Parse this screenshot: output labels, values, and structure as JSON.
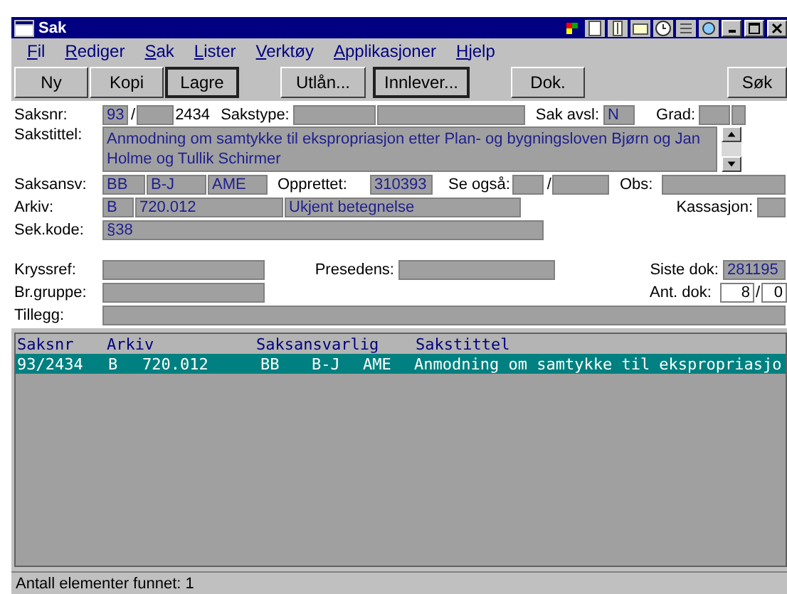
{
  "window": {
    "title": "Sak"
  },
  "menu": [
    {
      "label": "Fil"
    },
    {
      "label": "Rediger"
    },
    {
      "label": "Sak"
    },
    {
      "label": "Lister"
    },
    {
      "label": "Verktøy"
    },
    {
      "label": "Applikasjoner"
    },
    {
      "label": "Hjelp"
    }
  ],
  "toolbar": [
    {
      "label": "Ny",
      "default": false
    },
    {
      "label": "Kopi",
      "default": false
    },
    {
      "label": "Lagre",
      "default": true
    },
    {
      "label": "Utlån...",
      "default": false
    },
    {
      "label": "Innlever...",
      "default": true
    },
    {
      "label": "Dok.",
      "default": false
    },
    {
      "label": "Søk",
      "default": false
    }
  ],
  "form": {
    "saksnr": {
      "label": "Saksnr:",
      "year": "93",
      "slash": "/",
      "number": "2434"
    },
    "sakstype": {
      "label": "Sakstype:"
    },
    "sak_avsl": {
      "label": "Sak avsl:",
      "value": "N"
    },
    "grad": {
      "label": "Grad:"
    },
    "sakstittel": {
      "label": "Sakstittel:",
      "value": "Anmodning om samtykke til ekspropriasjon etter Plan- og bygningsloven Bjørn og Jan Holme og Tullik Schirmer"
    },
    "saksansv": {
      "label": "Saksansv:",
      "values": [
        "BB",
        "B-J",
        "AME"
      ]
    },
    "opprettet": {
      "label": "Opprettet:",
      "value": "310393"
    },
    "se_ogsa": {
      "label": "Se også:",
      "slash": "/"
    },
    "obs": {
      "label": "Obs:"
    },
    "arkiv": {
      "label": "Arkiv:",
      "series": "B",
      "code": "720.012",
      "description": "Ukjent betegnelse"
    },
    "kassasjon": {
      "label": "Kassasjon:"
    },
    "sek_kode": {
      "label": "Sek.kode:",
      "value": "§38"
    },
    "kryssref": {
      "label": "Kryssref:"
    },
    "presedens": {
      "label": "Presedens:"
    },
    "siste_dok": {
      "label": "Siste dok:",
      "value": "281195"
    },
    "br_gruppe": {
      "label": "Br.gruppe:"
    },
    "ant_dok": {
      "label": "Ant. dok:",
      "value": "8",
      "slash": "/",
      "second": "0"
    },
    "tillegg": {
      "label": "Tillegg:"
    }
  },
  "list": {
    "columns": [
      "Saksnr",
      "Arkiv",
      "Saksansvarlig",
      "Sakstittel"
    ],
    "rows": [
      {
        "saksnr": "93/2434",
        "arkiv": [
          "B",
          "720.012"
        ],
        "saksansvarlig": [
          "BB",
          "B-J",
          "AME"
        ],
        "sakstittel": "Anmodning om samtykke til ekspropriasjo",
        "selected": true
      }
    ]
  },
  "status_bar": {
    "text": "Antall elementer funnet: 1"
  }
}
